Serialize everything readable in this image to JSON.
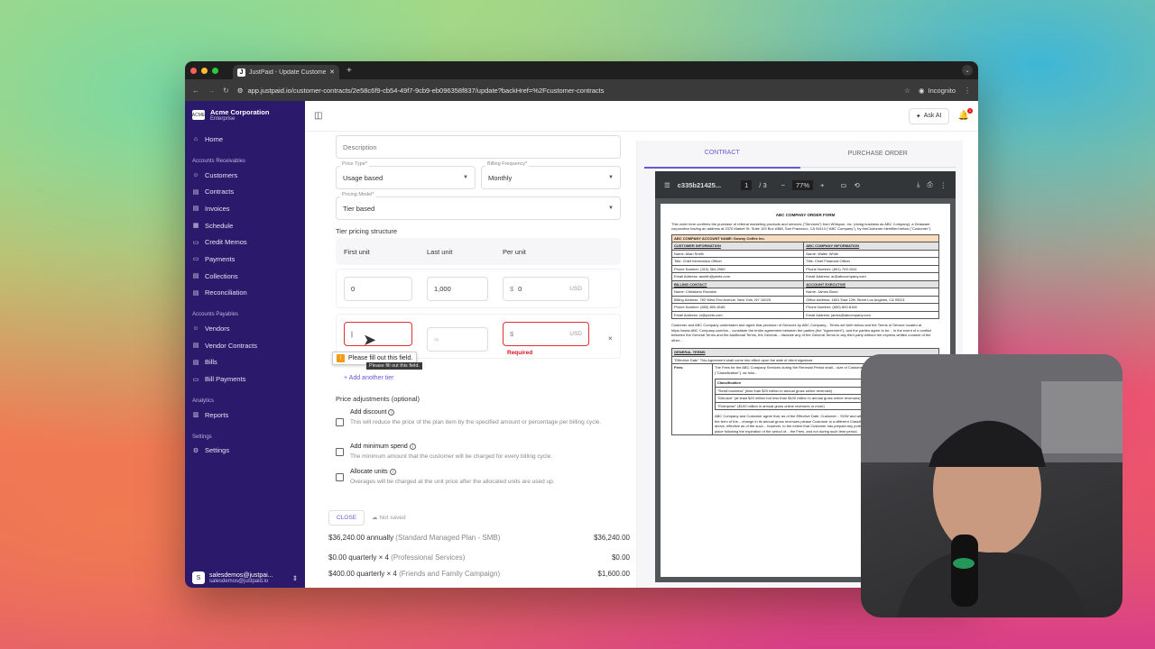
{
  "browser": {
    "tab_title": "JustPaid - Update Customer",
    "url": "app.justpaid.io/customer-contracts/2e58c6f9-cb54-49f7-9cb9-eb096358f837/update?backHref=%2Fcustomer-contracts",
    "incognito": "Incognito"
  },
  "org": {
    "name": "Acme Corporation",
    "plan": "Enterprise"
  },
  "sidebar": {
    "home": "Home",
    "sections": [
      "Accounts Receivables",
      "Accounts Payables",
      "Analytics",
      "Settings"
    ],
    "ar": [
      "Customers",
      "Contracts",
      "Invoices",
      "Schedule",
      "Credit Memos",
      "Payments",
      "Collections",
      "Reconciliation"
    ],
    "ap": [
      "Vendors",
      "Vendor Contracts",
      "Bills",
      "Bill Payments"
    ],
    "an": [
      "Reports"
    ],
    "st": [
      "Settings"
    ],
    "user_name": "salesdemos@justpai...",
    "user_email": "salesdemos@justpaid.io",
    "user_initial": "S"
  },
  "topbar": {
    "ask_ai": "Ask AI",
    "notif": "1"
  },
  "form": {
    "description_placeholder": "Description",
    "price_type_label": "Price Type*",
    "price_type": "Usage based",
    "billing_freq_label": "Billing Frequency*",
    "billing_freq": "Monthly",
    "pricing_model_label": "Pricing Model*",
    "pricing_model": "Tier based",
    "tier_title": "Tier pricing structure",
    "col_first": "First unit",
    "col_last": "Last unit",
    "col_per": "Per unit",
    "tier1": {
      "first": "0",
      "last": "1,000",
      "dollar": "$",
      "per": "0",
      "cur": "USD"
    },
    "tier2": {
      "last": "∞",
      "dollar": "$",
      "cur": "USD",
      "required": "Required",
      "remove": "×"
    },
    "tooltip": "Please fill out this field.",
    "tooltip_small": "Please fill out this field.",
    "add_tier": "+ Add another tier",
    "adj_title": "Price adjustments (optional)",
    "adj": [
      {
        "title": "Add discount",
        "desc": "This will reduce the price of the plan item by the specified amount or percentage per billing cycle."
      },
      {
        "title": "Add minimum spend",
        "desc": "The minimum amount that the customer will be charged for every billing cycle."
      },
      {
        "title": "Allocate units",
        "desc": "Overages will be charged at the unit price after the allocated units are used up."
      }
    ]
  },
  "footer": {
    "close": "CLOSE",
    "not_saved": "Not saved",
    "rows": [
      {
        "l": "$36,240.00 annually",
        "s": "(Standard Managed Plan - SMB)",
        "r": "$36,240.00"
      },
      {
        "l": "$0.00 quarterly × 4",
        "s": "(Professional Services)",
        "r": "$0.00"
      },
      {
        "l": "$400.00 quarterly × 4",
        "s": "(Friends and Family Campaign)",
        "r": "$1,600.00"
      }
    ]
  },
  "right": {
    "tab_contract": "CONTRACT",
    "tab_po": "PURCHASE ORDER",
    "pdf_name": "c335b21425...",
    "pdf_page": "1",
    "pdf_pages": "/ 3",
    "pdf_zoom": "77%",
    "doc_title": "ABC COMPANY ORDER FORM",
    "doc_intro": "This order form confirms the purchase of referral marketing products and services (\"Services\") from Whispon, Inc. (doing business as ABC Company), a Delaware corporation having an address at 2370 Market St. Suite 103 Box #388, San Francisco, CA 94114 (\"ABC Company\"), by theCustomer identified below (\"Customer\").",
    "acct_name": "ABC COMPANY ACCOUNT NAME: Downy Coffee Inc.",
    "cust_info": "CUSTOMER INFORMATION",
    "abc_info": "ABC COMPANY INFORMATION",
    "rows": [
      [
        "Name: Allan Smith",
        "Name: Walter White"
      ],
      [
        "Title: Chief Information Officer",
        "Title: Chief Financial Officer"
      ],
      [
        "Phone Number: (310) 364-2969",
        "Phone Number: (801) 709-1541"
      ],
      [
        "Email Address: asmith@peets.com",
        "Email Address: ar@abccompany.com"
      ]
    ],
    "billing": "BILLING CONTACT",
    "exec": "ACCOUNT EXECUTIVE",
    "rows2": [
      [
        "Name: Christiano Ronaldo",
        "Name: James Bond"
      ],
      [
        "Billing Address: 782 West End Avenue, New York, NY 10025",
        "Office Address: 1801 East 12th Street Los Angeles, CA 90021"
      ],
      [
        "Phone Number: (650) 800-8185",
        "Phone Number: (650) 800-8184"
      ],
      [
        "Email Address: cr@peets.com",
        "Email Address: james@abcompany.com"
      ]
    ],
    "doc_para": "Customer and ABC Company understand and agree that provision of Services by ABC Company... Terms set forth below and the Terms of Service located at https://www.ABC Company.com/tos... constitute the entire agreement between the parties (the \"Agreement\"), and the parties agree to be... In the event of a conflict between the General Terms and the Additional Terms, the General... disclose any of the General Terms to any third party without the express written consent of the other...",
    "gen_terms": "GENERAL TERMS",
    "eff_date": "\"Effective Date\" This Agreement shall come into effect upon the date of client signature.",
    "fees": "Fees:",
    "fees_text": "The Fees for the ABC Company Services during the Renewal Period shall... size of Customer's annual gross online revenues (\"Classification\"), as follo...",
    "class": "Classification",
    "class_items": [
      "\"Small business\" (less than $20 million in annual gross online revenues)",
      "\"Mid-size\" (at least $20 million but less than $100 million in annual gross online revenues)",
      "\"Enterprise\" ($100 million in annual gross online revenues or more)"
    ],
    "fees_more": "ABC Company and Customer agree that, as of the Effective Date, Customer... SOW and will be reassessed at each Renewal Date during the term of the... change in its annual gross revenues please Customer in a different Classif... shall be automatically adjusted as set forth above, effective as of the succ... however, to the extent that Customer has prepaid any portion of the Fees,... foregoing sentenceshall take place following the expiration of the period of... the Fees, and not during such time period."
  }
}
